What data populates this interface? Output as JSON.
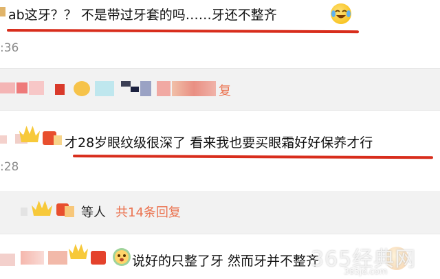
{
  "comments": [
    {
      "text": "ab这牙？？ 不是带过牙套的吗……牙还不整齐",
      "time": ":36"
    },
    {
      "text": "才28岁眼纹级很深了 看来我也要买眼霜好好保养才行",
      "time": ":28"
    },
    {
      "text": "说好的只整了牙 然而牙并不整齐"
    }
  ],
  "reply_row": {
    "text_suffix": "复"
  },
  "replies_summary": {
    "prefix": "等人",
    "count_link": "共14条回复"
  },
  "watermark": {
    "main": "365经典网",
    "sub": "365jd.com"
  },
  "colors": {
    "accent": "#eb7350",
    "underline": "#d82d1c",
    "band": "#f2f2f2"
  }
}
